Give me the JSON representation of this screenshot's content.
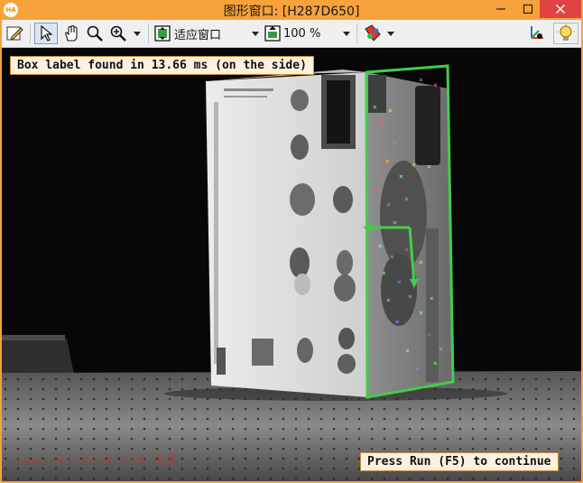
{
  "window": {
    "title": "图形窗口: [H287D650]",
    "app_icon_text": "HA",
    "controls": [
      "minimize",
      "maximize",
      "close"
    ]
  },
  "toolbar": {
    "zoom_mode_label": "适应窗口",
    "zoom_percent_label": "100 %",
    "icons": [
      "edit-icon",
      "pointer-icon",
      "pan-hand-icon",
      "magnify-icon",
      "zoom-in-icon",
      "fit-window-icon",
      "zoom-percent-icon",
      "color-palette-icon",
      "axes-icon",
      "lightbulb-icon"
    ]
  },
  "canvas": {
    "status_message": "Box label found in 13.66 ms (on the side)",
    "continue_message": "Press Run (F5) to continue",
    "watermark": "www.skcircle.com 勇哥",
    "colors": {
      "detected_region": "#3fcf4a",
      "message_background": "#fff1de"
    }
  }
}
